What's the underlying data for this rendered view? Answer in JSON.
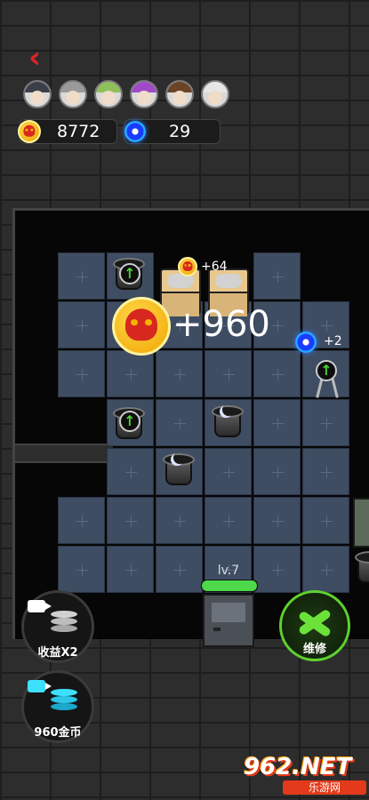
{
  "header": {
    "back_icon": "chevron-left-icon",
    "avatars": [
      {
        "name": "avatar-masked-boy",
        "hair": "#3a3f4a"
      },
      {
        "name": "avatar-grey-hair",
        "hair": "#9a9a9a"
      },
      {
        "name": "avatar-green-hair",
        "hair": "#8fbf5a"
      },
      {
        "name": "avatar-purple-hair",
        "hair": "#a04ac8"
      },
      {
        "name": "avatar-brown-hair",
        "hair": "#6b4327"
      },
      {
        "name": "avatar-bald-glasses",
        "hair": "#e6e6e6"
      }
    ]
  },
  "resources": {
    "coins": "8772",
    "gems": "29"
  },
  "field": {
    "popup_coin_gain": "+64",
    "big_coin_gain": "+960",
    "gem_gain": "+2"
  },
  "door": {
    "level": "lv.7",
    "progress": 1.0
  },
  "buttons": {
    "double_income": "收益X2",
    "coins_reward": "960金币",
    "repair": "维修"
  },
  "watermark": {
    "main": "962.NET",
    "sub": "乐游网"
  },
  "colors": {
    "accent_red": "#e0232a",
    "coin_gold": "#f0a500",
    "repair_green": "#5fd12f",
    "level_green": "#4dd94a",
    "gem_blue": "#2aa7ff"
  }
}
